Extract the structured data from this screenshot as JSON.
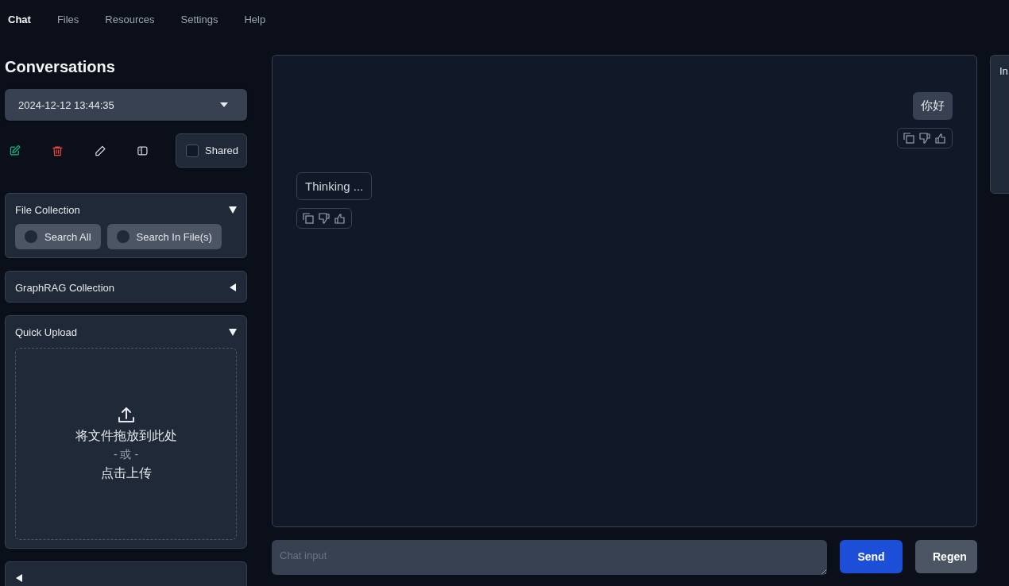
{
  "nav_tabs": [
    {
      "label": "Chat",
      "selected": true
    },
    {
      "label": "Files",
      "selected": false
    },
    {
      "label": "Resources",
      "selected": false
    },
    {
      "label": "Settings",
      "selected": false
    },
    {
      "label": "Help",
      "selected": false
    }
  ],
  "sidebar": {
    "title": "Conversations",
    "conversation_select": {
      "value": "2024-12-12 13:44:35"
    },
    "shared_checkbox": {
      "label": "Shared",
      "checked": false
    },
    "panels": [
      {
        "kind": "radios",
        "title": "File Collection",
        "expanded": true,
        "options": [
          {
            "label": "Search All",
            "selected": false
          },
          {
            "label": "Search In File(s)",
            "selected": false
          }
        ]
      },
      {
        "title": "GraphRAG Collection",
        "expanded": false
      },
      {
        "kind": "upload",
        "title": "Quick Upload",
        "expanded": true,
        "drop_text": "将文件拖放到此处",
        "or_text": "- 或 -",
        "click_text": "点击上传"
      },
      {
        "expanded": false
      }
    ]
  },
  "chat": {
    "messages": [
      {
        "kind": "sent",
        "text": "你好"
      },
      {
        "kind": "received",
        "text": "Thinking ..."
      }
    ],
    "input": {
      "placeholder": "Chat input"
    },
    "buttons": [
      {
        "label": "Send",
        "kind": "primary"
      },
      {
        "label": "Regen",
        "kind": "secondary"
      }
    ]
  },
  "info_panel": {
    "title": "In"
  }
}
